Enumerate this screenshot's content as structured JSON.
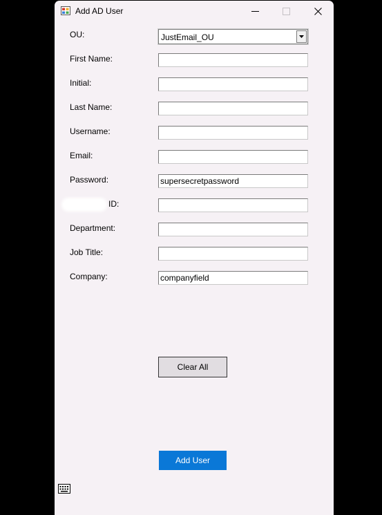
{
  "window": {
    "title": "Add AD User",
    "icon": "app-window-icon"
  },
  "title_buttons": {
    "minimize": "minimize-icon",
    "maximize": "maximize-icon",
    "close": "close-icon"
  },
  "form": {
    "ou_label": "OU:",
    "ou_value": "JustEmail_OU",
    "first_name_label": "First Name:",
    "first_name_value": "",
    "initial_label": "Initial:",
    "initial_value": "",
    "last_name_label": "Last Name:",
    "last_name_value": "",
    "username_label": "Username:",
    "username_value": "",
    "email_label": "Email:",
    "email_value": "",
    "password_label": "Password:",
    "password_value": "supersecretpassword",
    "id_label": "ID:",
    "id_value": "",
    "department_label": "Department:",
    "department_value": "",
    "job_title_label": "Job Title:",
    "job_title_value": "",
    "company_label": "Company:",
    "company_value": "companyfield"
  },
  "buttons": {
    "clear_all": "Clear All",
    "add_user": "Add User"
  },
  "colors": {
    "window_bg": "#f6f1f5",
    "accent": "#0a78d7",
    "desktop": "#000000"
  }
}
